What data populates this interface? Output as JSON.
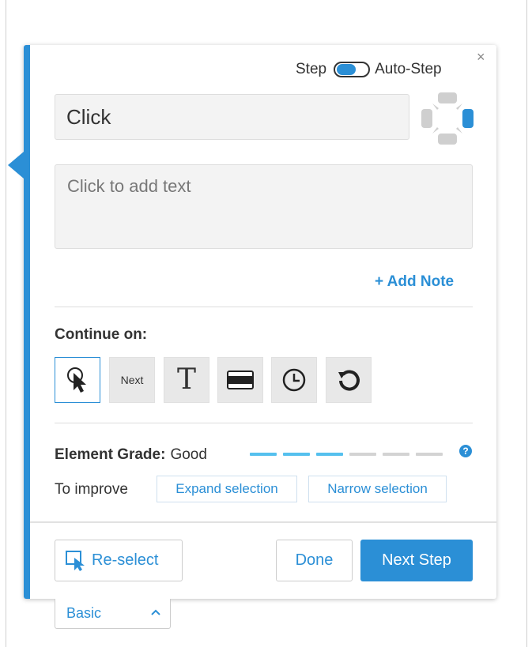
{
  "header": {
    "step_label": "Step",
    "auto_step_label": "Auto-Step",
    "close_glyph": "×"
  },
  "action": {
    "value": "Click",
    "icon": "move-arrows-icon"
  },
  "text_area": {
    "placeholder": "Click to add text"
  },
  "add_note_label": "+ Add Note",
  "continue_on": {
    "label": "Continue on:",
    "options": [
      {
        "name": "cursor-click",
        "label": "",
        "selected": true
      },
      {
        "name": "next",
        "label": "Next"
      },
      {
        "name": "text",
        "label": "T"
      },
      {
        "name": "element",
        "label": ""
      },
      {
        "name": "timer",
        "label": ""
      },
      {
        "name": "refresh",
        "label": ""
      }
    ]
  },
  "grade": {
    "label": "Element Grade:",
    "value": "Good",
    "level": 3,
    "max": 6,
    "active_color": "#55c0ee",
    "inactive_color": "#d3d3d3",
    "help_glyph": "?"
  },
  "improve": {
    "label": "To improve",
    "expand_label": "Expand selection",
    "narrow_label": "Narrow selection"
  },
  "footer": {
    "reselect_label": "Re-select",
    "done_label": "Done",
    "next_label": "Next Step"
  },
  "basic_select": {
    "value": "Basic"
  },
  "colors": {
    "accent": "#2b8fd6"
  }
}
